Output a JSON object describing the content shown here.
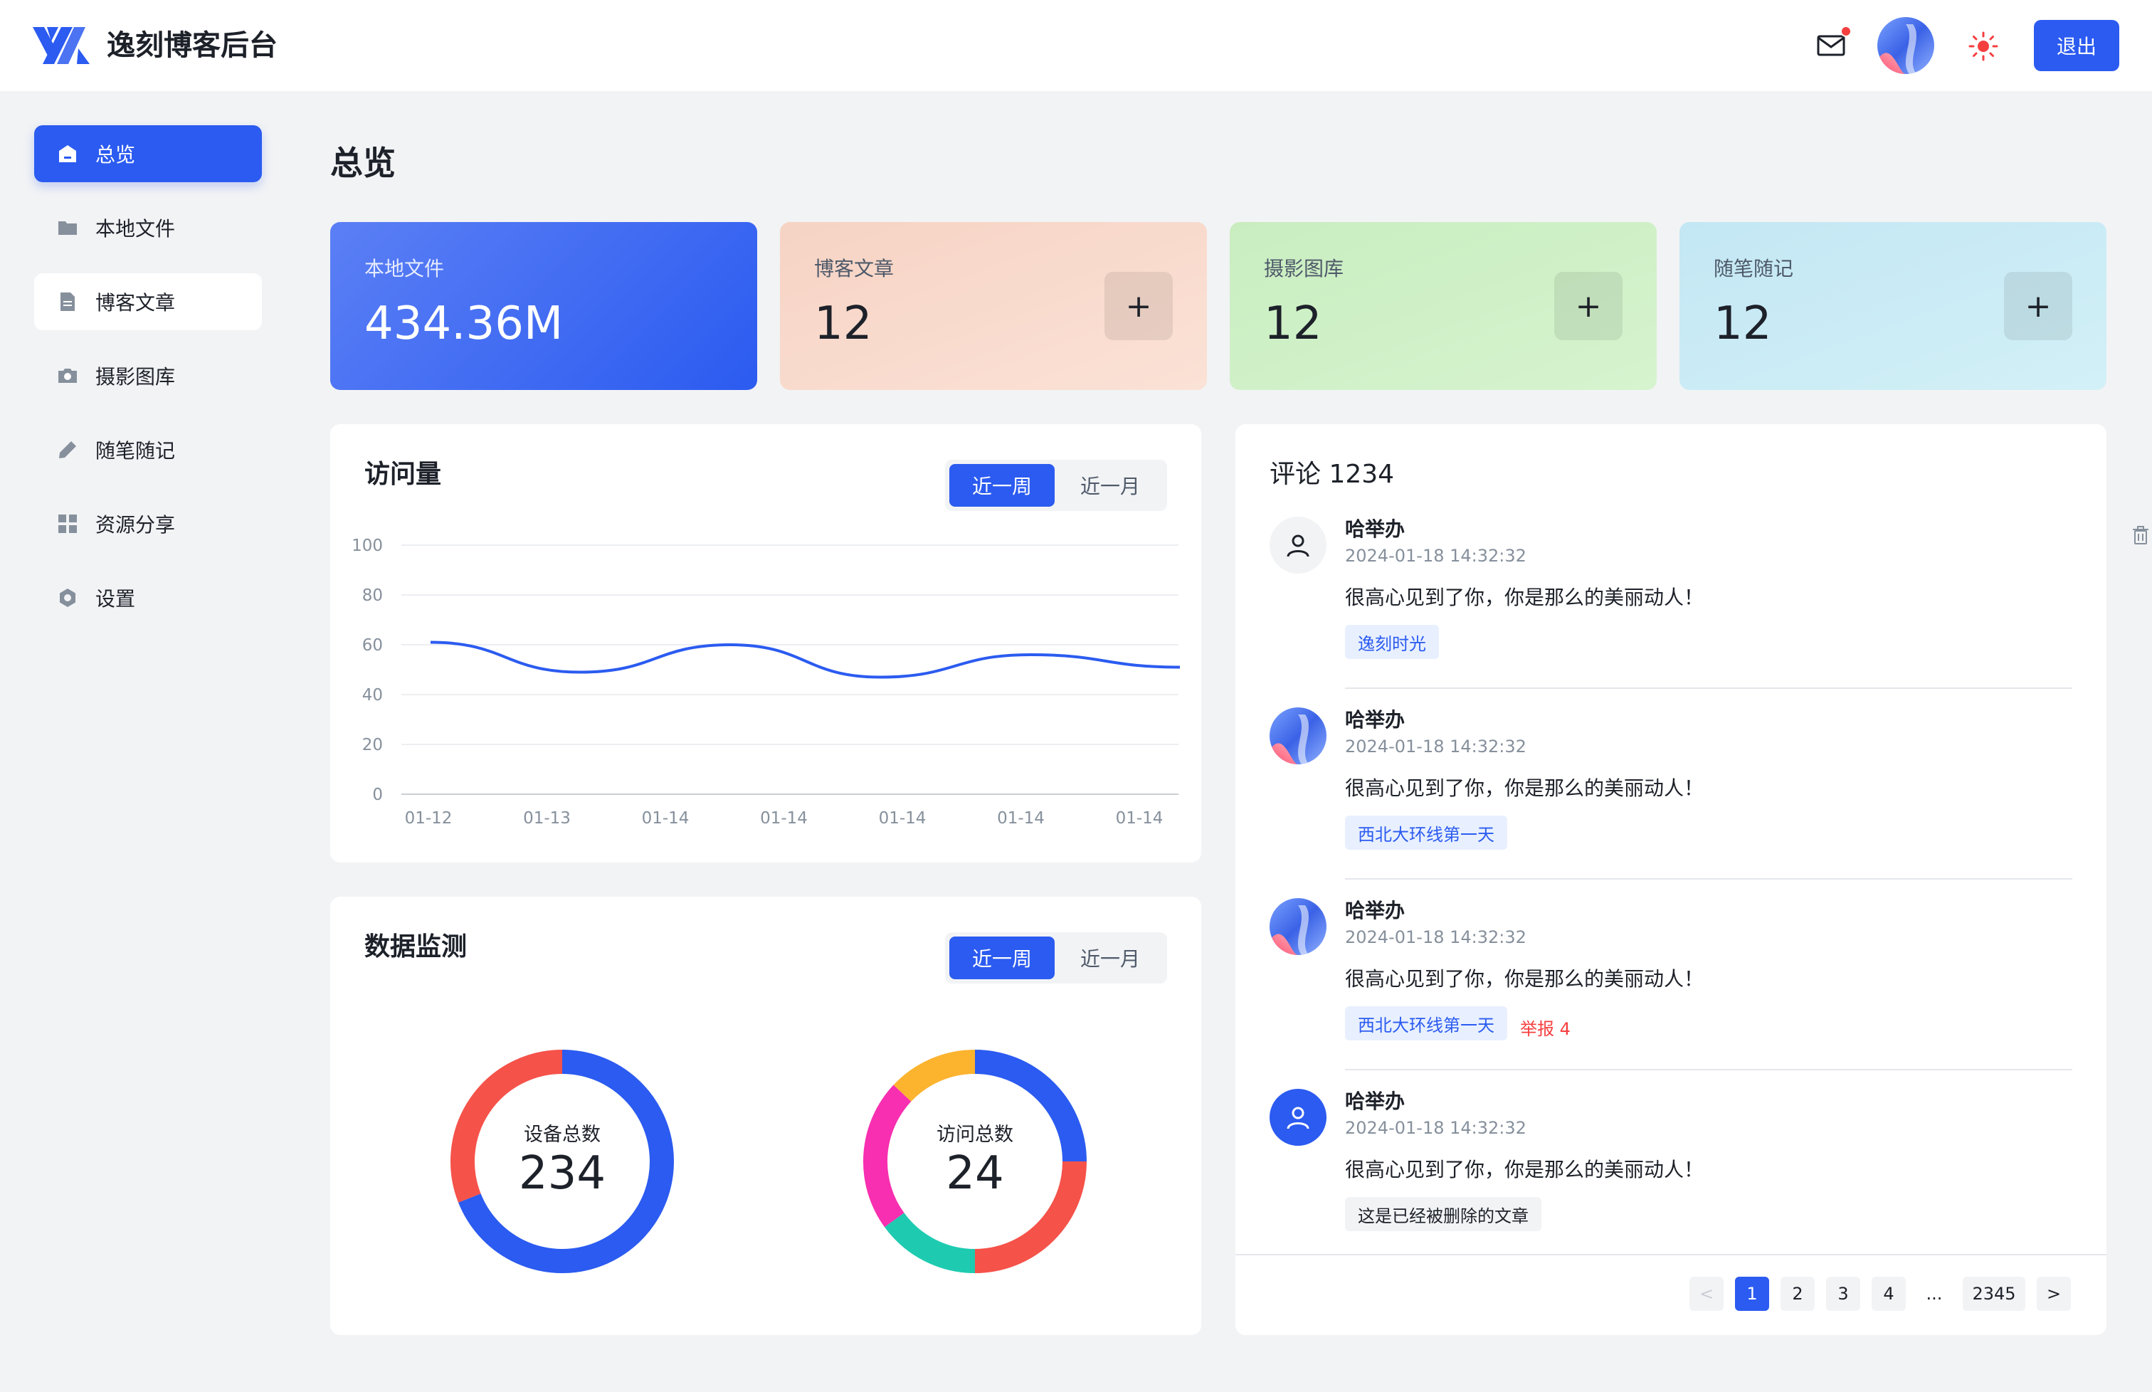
{
  "header": {
    "app_title": "逸刻博客后台",
    "logout_label": "退出",
    "icons": {
      "logo": "logo-icon",
      "mail": "mail-icon",
      "theme": "sun-icon"
    }
  },
  "sidebar": {
    "items": [
      {
        "label": "总览",
        "icon": "home-icon",
        "state": "active"
      },
      {
        "label": "本地文件",
        "icon": "folder-icon",
        "state": "normal"
      },
      {
        "label": "博客文章",
        "icon": "document-icon",
        "state": "hover"
      },
      {
        "label": "摄影图库",
        "icon": "camera-icon",
        "state": "normal"
      },
      {
        "label": "随笔随记",
        "icon": "pencil-icon",
        "state": "normal"
      },
      {
        "label": "资源分享",
        "icon": "grid-icon",
        "state": "normal"
      },
      {
        "label": "设置",
        "icon": "gear-icon",
        "state": "normal"
      }
    ]
  },
  "page": {
    "title": "总览"
  },
  "stats": [
    {
      "label": "本地文件",
      "value": "434.36M",
      "color": "#2b5bf0"
    },
    {
      "label": "博客文章",
      "value": "12",
      "add_label": "+",
      "color": "#f7d6c9"
    },
    {
      "label": "摄影图库",
      "value": "12",
      "add_label": "+",
      "color": "#cdf0c6"
    },
    {
      "label": "随笔随记",
      "value": "12",
      "add_label": "+",
      "color": "#c6eaf5"
    }
  ],
  "visits": {
    "title": "访问量",
    "range_options": [
      "近一周",
      "近一月"
    ],
    "selected_range": "近一周"
  },
  "chart_data": {
    "type": "line",
    "title": "访问量",
    "categories": [
      "01-12",
      "01-13",
      "01-14",
      "01-14",
      "01-14",
      "01-14",
      "01-14"
    ],
    "series": [
      {
        "values": [
          61,
          49,
          60,
          47,
          56,
          51
        ]
      }
    ],
    "x_points": [
      0,
      1,
      2,
      3,
      4,
      5
    ],
    "yticks": [
      "0",
      "20",
      "40",
      "60",
      "80",
      "100"
    ],
    "ylim": [
      0,
      100
    ],
    "grid": true,
    "line_color": "#2b5bf0"
  },
  "monitor": {
    "title": "数据监测",
    "range_options": [
      "近一周",
      "近一月"
    ],
    "selected_range": "近一周",
    "donuts": [
      {
        "label": "设备总数",
        "value": "234",
        "segments": [
          {
            "fraction": 0.69,
            "color": "#2b5bf0"
          },
          {
            "fraction": 0.31,
            "color": "#f5524a"
          }
        ]
      },
      {
        "label": "访问总数",
        "value": "24",
        "segments": [
          {
            "fraction": 0.25,
            "color": "#2b5bf0"
          },
          {
            "fraction": 0.25,
            "color": "#f5524a"
          },
          {
            "fraction": 0.15,
            "color": "#1ecbb0"
          },
          {
            "fraction": 0.22,
            "color": "#f72fb0"
          },
          {
            "fraction": 0.13,
            "color": "#fcb32e"
          }
        ]
      }
    ]
  },
  "comments": {
    "title": "评论 1234",
    "items": [
      {
        "name": "哈举办",
        "time": "2024-01-18 14:32:32",
        "text": "很高心见到了你，你是那么的美丽动人！",
        "tag": "逸刻时光",
        "tag_style": "blue",
        "avatar": "user-icon",
        "report": ""
      },
      {
        "name": "哈举办",
        "time": "2024-01-18 14:32:32",
        "text": "很高心见到了你，你是那么的美丽动人！",
        "tag": "西北大环线第一天",
        "tag_style": "blue",
        "avatar": "gradient-avatar",
        "report": ""
      },
      {
        "name": "哈举办",
        "time": "2024-01-18 14:32:32",
        "text": "很高心见到了你，你是那么的美丽动人！",
        "tag": "西北大环线第一天",
        "tag_style": "blue",
        "avatar": "gradient-avatar",
        "report": "举报 4"
      },
      {
        "name": "哈举办",
        "time": "2024-01-18 14:32:32",
        "text": "很高心见到了你，你是那么的美丽动人！",
        "tag": "这是已经被删除的文章",
        "tag_style": "gray",
        "avatar": "user-icon-filled",
        "report": ""
      }
    ],
    "pagination": {
      "pages": [
        "1",
        "2",
        "3",
        "4"
      ],
      "ellipsis": "...",
      "last": "2345",
      "current": "1",
      "prev": "<",
      "next": ">"
    }
  }
}
